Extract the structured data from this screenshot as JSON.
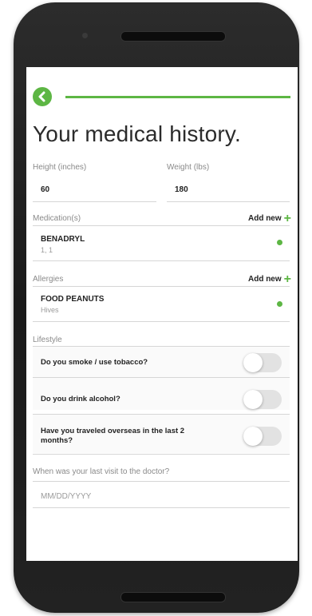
{
  "page": {
    "title": "Your medical history."
  },
  "height": {
    "label": "Height (inches)",
    "value": "60"
  },
  "weight": {
    "label": "Weight (lbs)",
    "value": "180"
  },
  "medications": {
    "label": "Medication(s)",
    "add_label": "Add new",
    "items": [
      {
        "name": "BENADRYL",
        "detail": "1, 1"
      }
    ]
  },
  "allergies": {
    "label": "Allergies",
    "add_label": "Add new",
    "items": [
      {
        "name": "FOOD PEANUTS",
        "detail": "Hives"
      }
    ]
  },
  "lifestyle": {
    "label": "Lifestyle",
    "questions": [
      {
        "text": "Do you smoke / use tobacco?",
        "on": false
      },
      {
        "text": "Do you drink alcohol?",
        "on": false
      },
      {
        "text": "Have you traveled overseas in the last 2 months?",
        "on": false
      }
    ]
  },
  "last_visit": {
    "label": "When was your last visit to the doctor?",
    "placeholder": "MM/DD/YYYY"
  },
  "colors": {
    "accent": "#5db644"
  },
  "icons": {
    "back": "chevron-left-icon",
    "add": "plus-icon"
  }
}
